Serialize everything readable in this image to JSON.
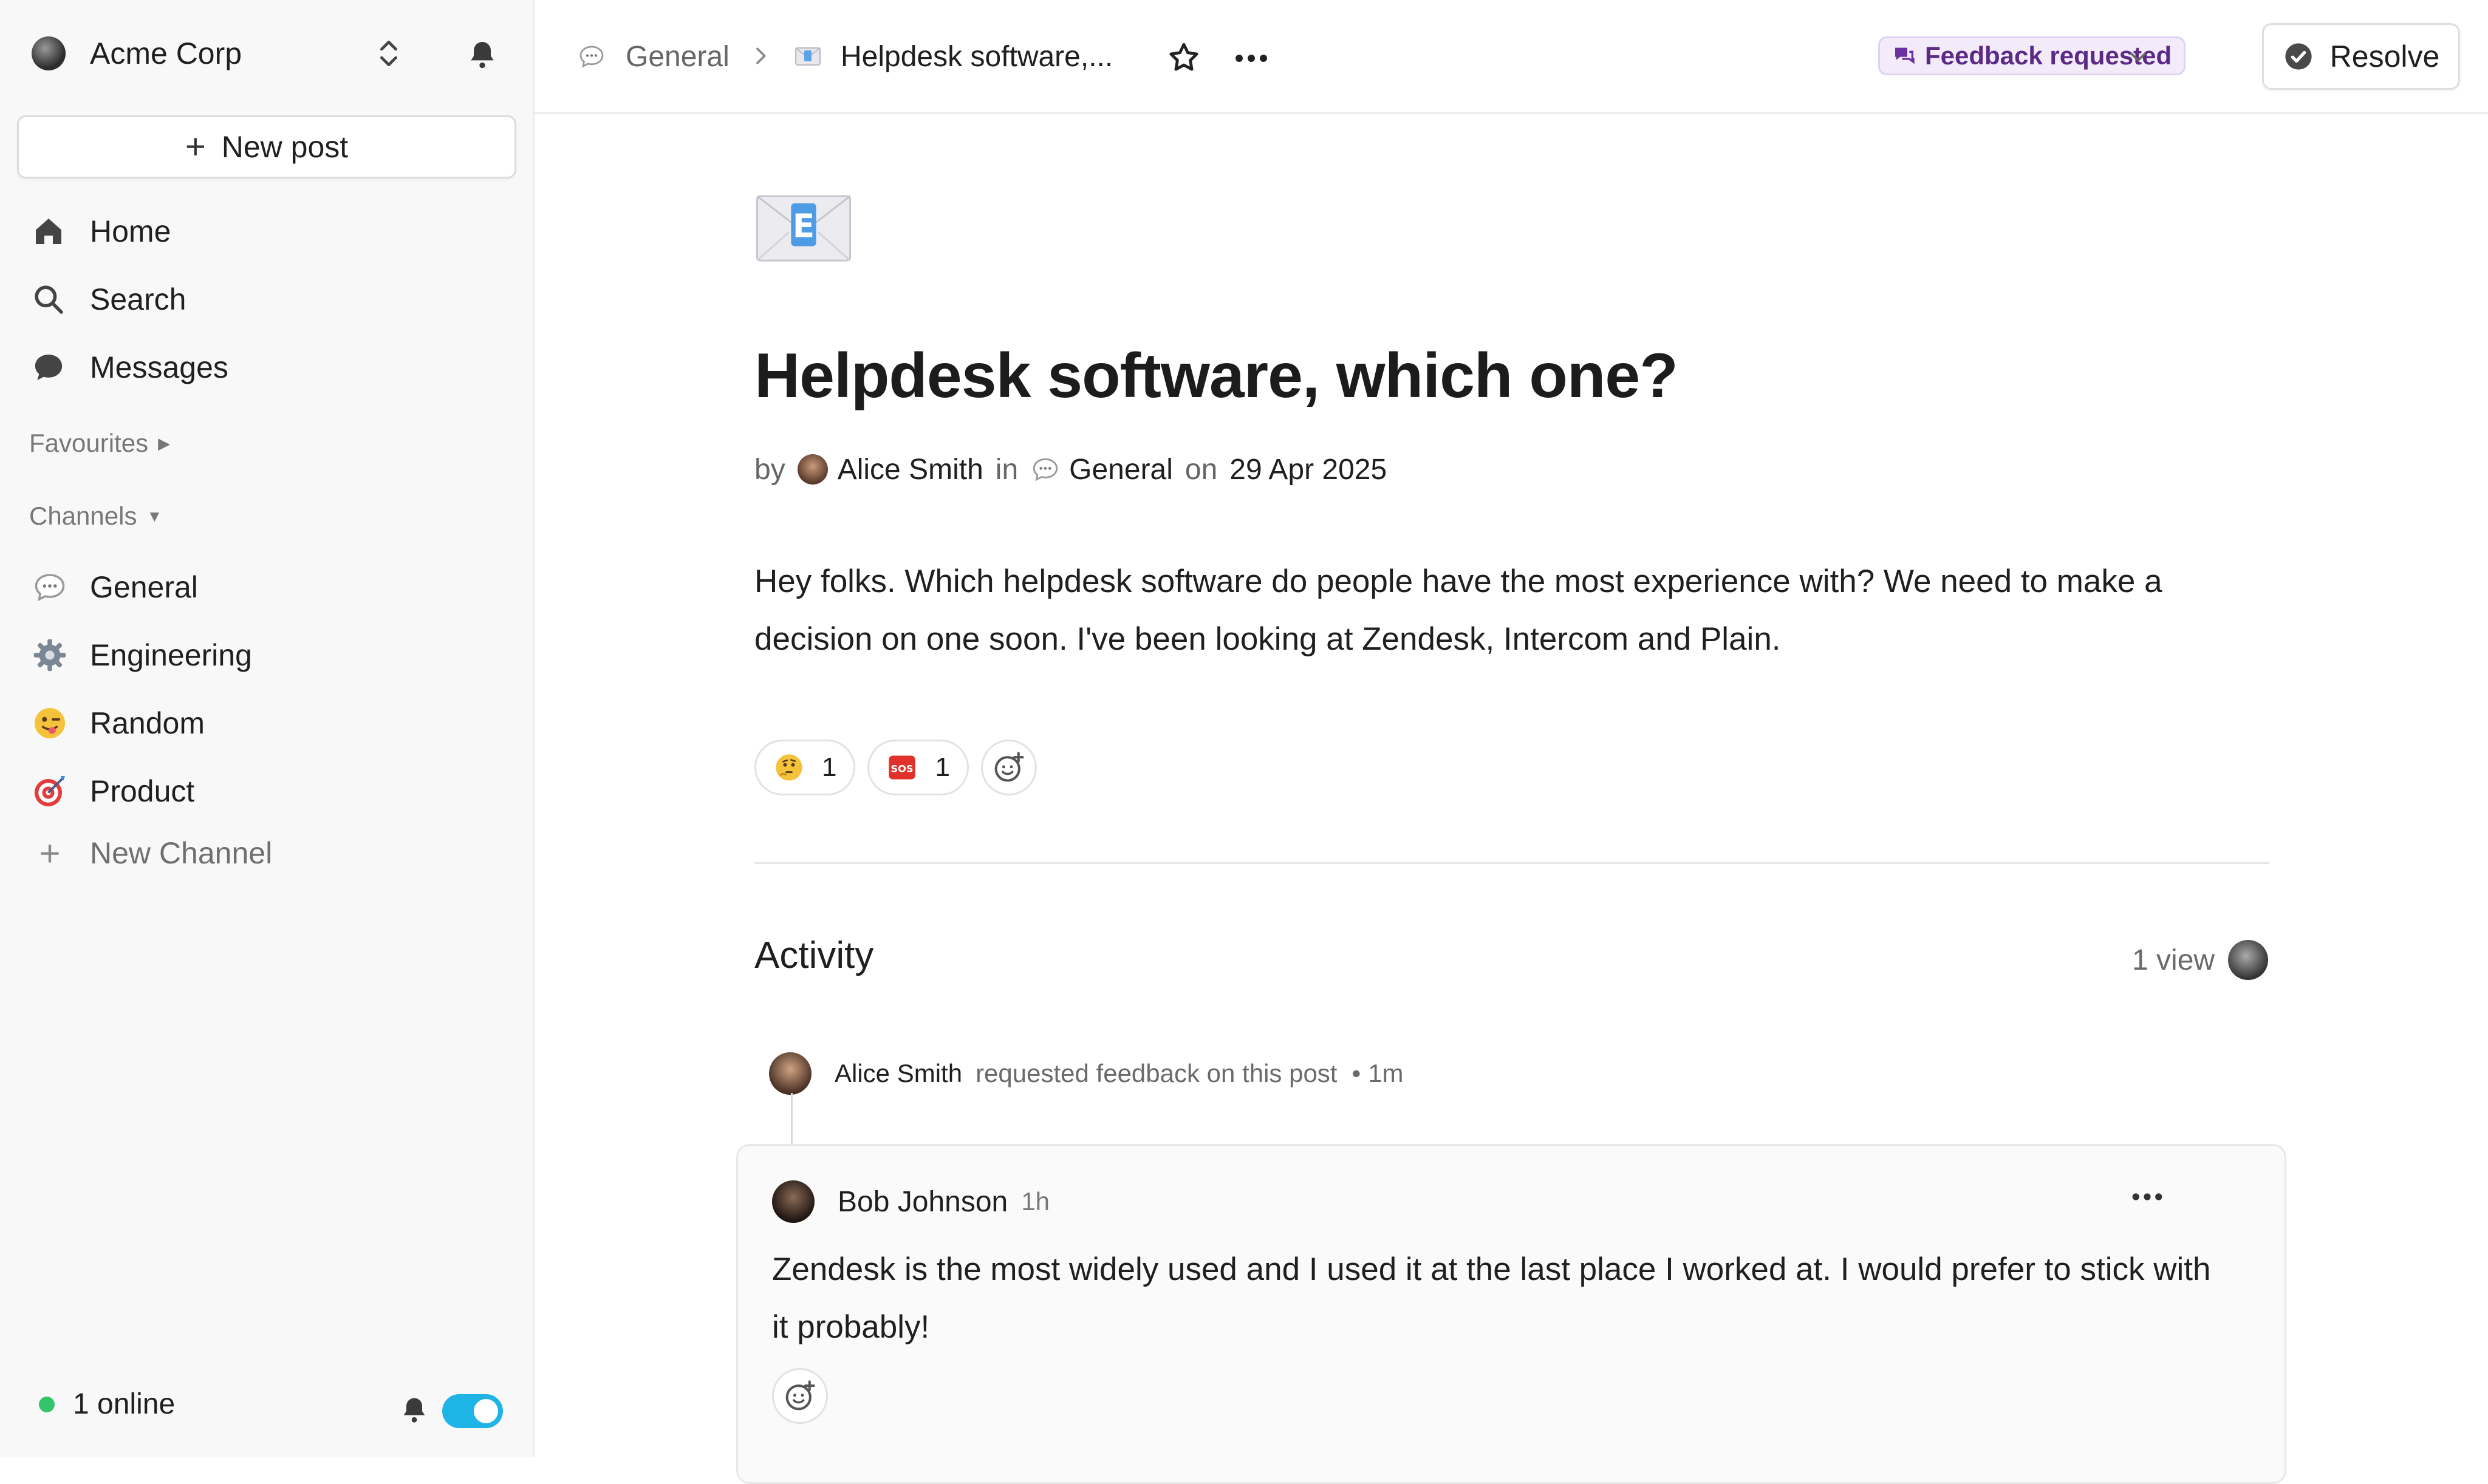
{
  "sidebar": {
    "workspace": {
      "name": "Acme Corp"
    },
    "new_post_label": "New post",
    "nav": [
      {
        "label": "Home",
        "icon": "home-icon"
      },
      {
        "label": "Search",
        "icon": "search-icon"
      },
      {
        "label": "Messages",
        "icon": "message-icon"
      }
    ],
    "favourites_label": "Favourites",
    "channels_label": "Channels",
    "channels": [
      {
        "label": "General",
        "icon": "speech-bubble-emoji"
      },
      {
        "label": "Engineering",
        "icon": "gear-emoji"
      },
      {
        "label": "Random",
        "icon": "winking-tongue-emoji"
      },
      {
        "label": "Product",
        "icon": "target-emoji"
      }
    ],
    "new_channel_label": "New Channel",
    "online_label": "1 online",
    "accent_color": "#1fb4e6",
    "online_color": "#35c46a"
  },
  "header": {
    "breadcrumb_channel": "General",
    "breadcrumb_post": "Helpdesk software,...",
    "status_badge": "Feedback requested",
    "resolve_label": "Resolve",
    "badge_color": "#5b2a86"
  },
  "post": {
    "icon": "envelope-e-emoji",
    "title": "Helpdesk software, which one?",
    "meta": {
      "by": "by",
      "author": "Alice Smith",
      "in": "in",
      "channel": "General",
      "on": "on",
      "date": "29 Apr 2025"
    },
    "body": "Hey folks. Which helpdesk software do people have the most experience with? We need to make a decision on one soon. I've been looking at Zendesk, Intercom and Plain.",
    "reactions": [
      {
        "emoji": "thinking-face-emoji",
        "count": "1"
      },
      {
        "emoji": "sos-emoji",
        "count": "1"
      }
    ]
  },
  "activity": {
    "title": "Activity",
    "views": "1 view",
    "events": [
      {
        "actor": "Alice Smith",
        "action": "requested feedback on this post",
        "time": "1m"
      }
    ],
    "comments": [
      {
        "author": "Bob Johnson",
        "time": "1h",
        "text": "Zendesk is the most widely used and I used it at the last place I worked at. I would prefer to stick with it probably!"
      }
    ]
  }
}
